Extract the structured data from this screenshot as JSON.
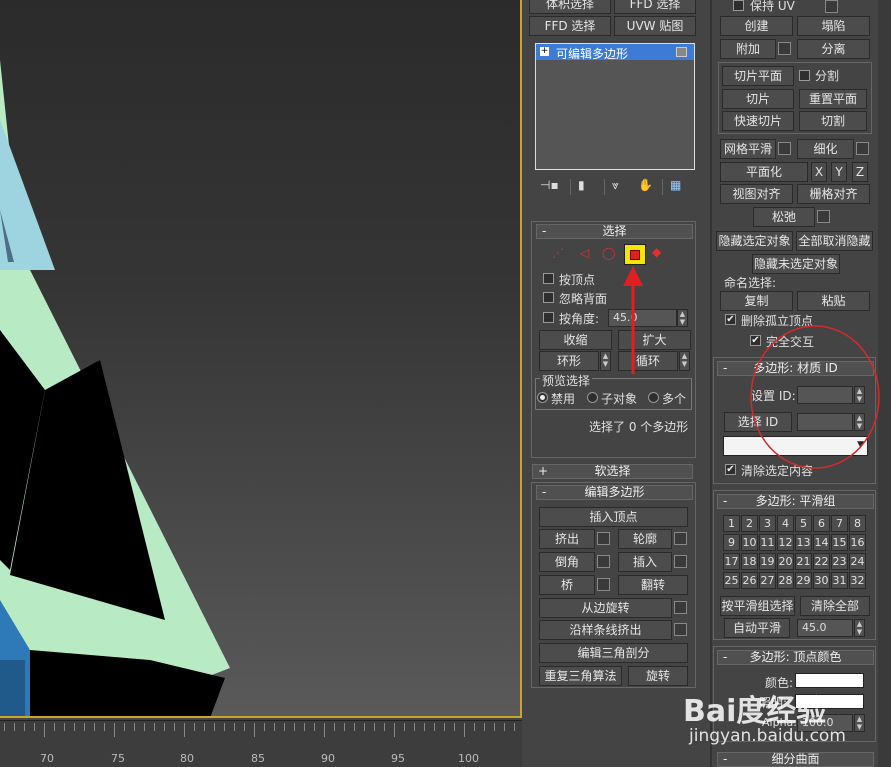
{
  "ruler": {
    "labels": [
      "70",
      "75",
      "80",
      "85",
      "90",
      "95",
      "100"
    ]
  },
  "modifier_stack": {
    "top_buttons": [
      "体积选择",
      "FFD 选择",
      "FFD 选择",
      "UVW 贴图"
    ],
    "item": "可编辑多边形"
  },
  "selection_rollout": {
    "title": "选择",
    "by_vertex": "按顶点",
    "ignore_backface": "忽略背面",
    "by_angle": "按角度:",
    "angle_value": "45.0",
    "shrink": "收缩",
    "grow": "扩大",
    "ring": "环形",
    "loop": "循环",
    "preview_title": "预览选择",
    "preview_options": [
      "禁用",
      "子对象",
      "多个"
    ],
    "status": "选择了 0 个多边形"
  },
  "soft_selection": {
    "title": "软选择"
  },
  "edit_polygons": {
    "title": "编辑多边形",
    "insert_vertex": "插入顶点",
    "extrude": "挤出",
    "outline": "轮廓",
    "bevel": "倒角",
    "inset": "插入",
    "bridge": "桥",
    "flip": "翻转",
    "hinge": "从边旋转",
    "extrude_spline": "沿样条线挤出",
    "edit_tri": "编辑三角剖分",
    "retriangulate": "重复三角算法",
    "turn": "旋转"
  },
  "edit_geometry": {
    "preserve_uv": "保持 UV",
    "create": "创建",
    "collapse": "塌陷",
    "attach": "附加",
    "detach": "分离",
    "slice_plane": "切片平面",
    "split": "分割",
    "slice": "切片",
    "reset_plane": "重置平面",
    "quickslice": "快速切片",
    "cut": "切割",
    "meshsmooth": "网格平滑",
    "tessellate": "细化",
    "make_planar": "平面化",
    "x": "X",
    "y": "Y",
    "z": "Z",
    "view_align": "视图对齐",
    "grid_align": "栅格对齐",
    "relax": "松弛",
    "hide_selected": "隐藏选定对象",
    "unhide_all": "全部取消隐藏",
    "hide_unselected": "隐藏未选定对象",
    "named_sel": "命名选择:",
    "copy": "复制",
    "paste": "粘贴",
    "delete_isolated": "删除孤立顶点",
    "full_interactivity": "完全交互"
  },
  "material_ids": {
    "title": "多边形: 材质 ID",
    "set_id": "设置 ID:",
    "select_id": "选择 ID",
    "clear_selection": "清除选定内容"
  },
  "smoothing_groups": {
    "title": "多边形: 平滑组",
    "groups": [
      "1",
      "2",
      "3",
      "4",
      "5",
      "6",
      "7",
      "8",
      "9",
      "10",
      "11",
      "12",
      "13",
      "14",
      "15",
      "16",
      "17",
      "18",
      "19",
      "20",
      "21",
      "22",
      "23",
      "24",
      "25",
      "26",
      "27",
      "28",
      "29",
      "30",
      "31",
      "32"
    ],
    "select_by_sg": "按平滑组选择",
    "clear_all": "清除全部",
    "auto_smooth": "自动平滑",
    "threshold": "45.0"
  },
  "vertex_colors": {
    "title": "多边形: 顶点颜色",
    "color": "颜色:",
    "illumination": "照明:",
    "alpha": "Alpha:",
    "alpha_value": "100.0"
  },
  "subdivision": {
    "title": "细分曲面"
  },
  "watermark": {
    "brand": "Bai度经验",
    "url": "jingyan.baidu.com"
  },
  "colors": {
    "accent_red": "#e02020",
    "highlight_yellow": "#f5e600",
    "stack_selected": "#3d7cd6"
  }
}
